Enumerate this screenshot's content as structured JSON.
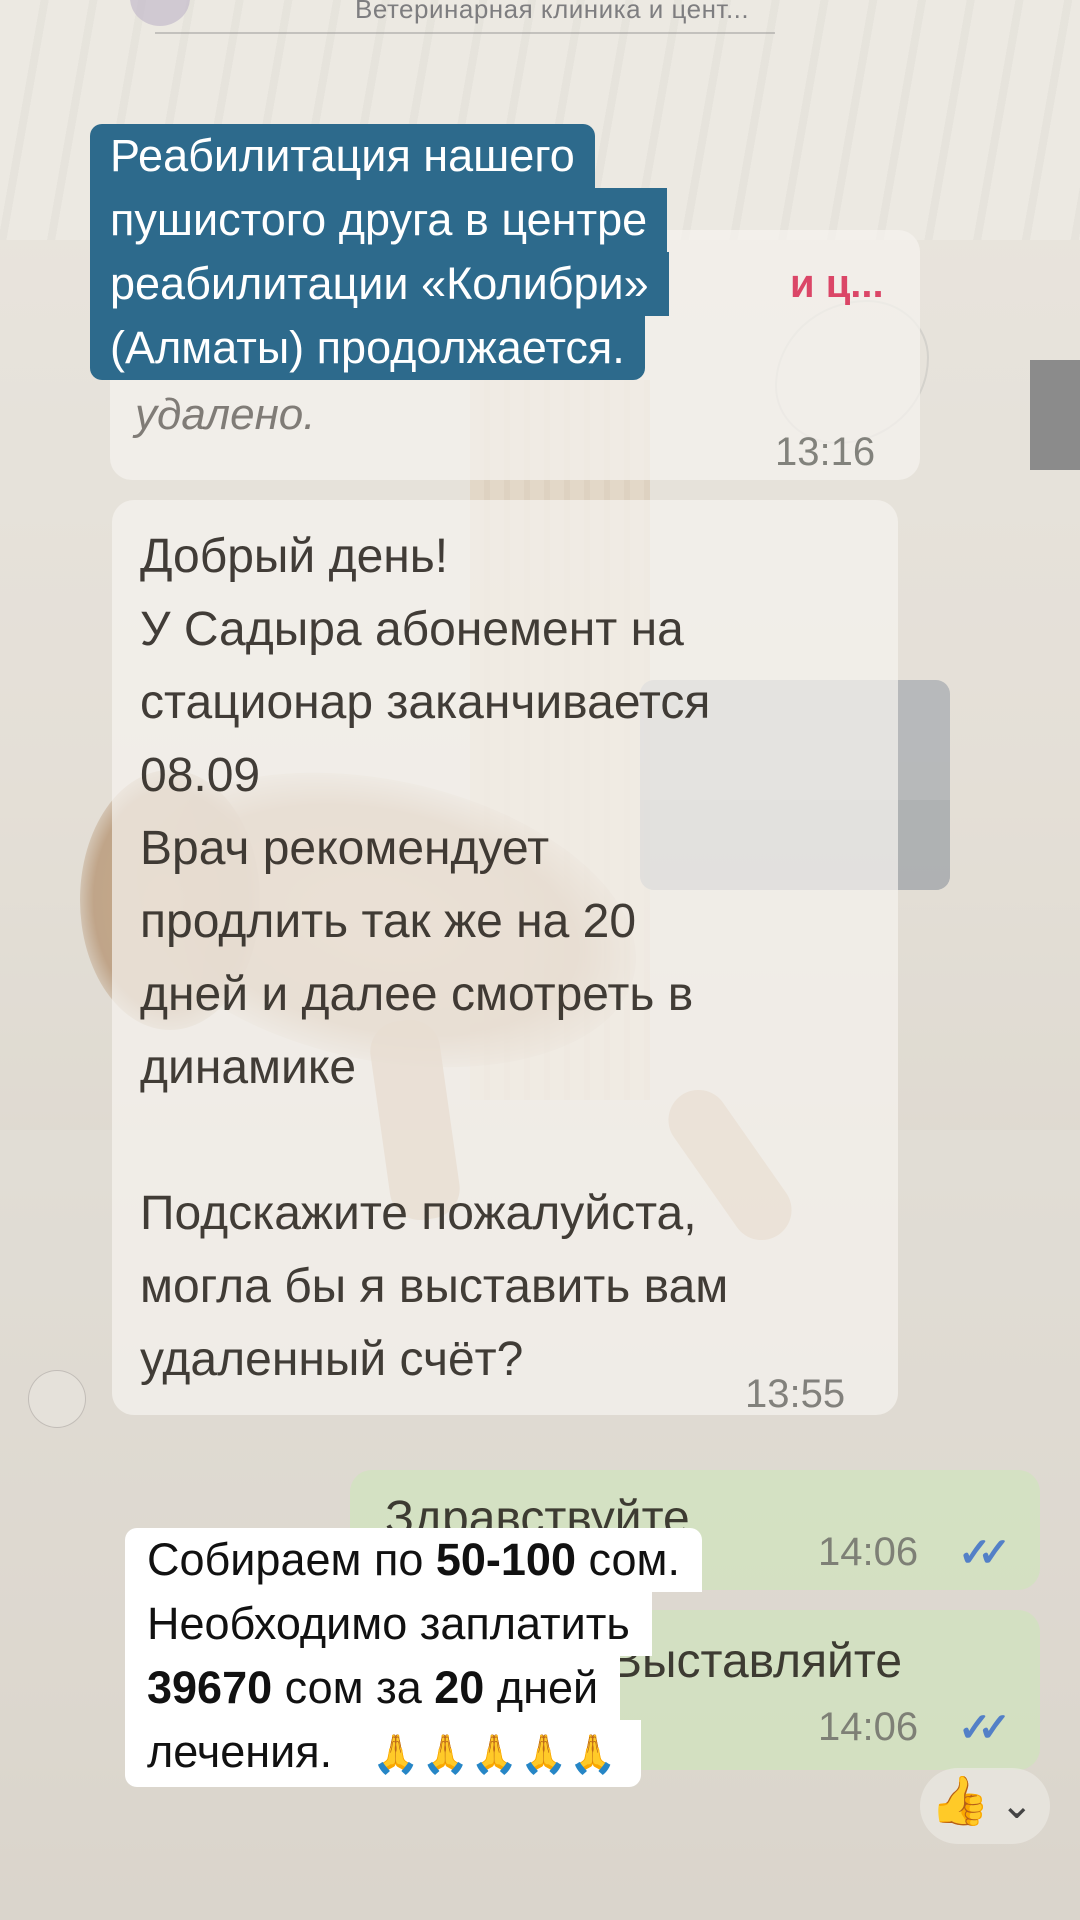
{
  "chat": {
    "title": "Ветеринарная клиника и цент...",
    "reply_preview": {
      "name_fragment": "и ц...",
      "deleted_text": "удалено.",
      "time": "13:16"
    },
    "incoming_message": {
      "text": "Добрый день!\nУ Садыра абонемент на\nстационар заканчивается\n08.09\nВрач рекомендует\nпродлить так же на 20\nдней и далее смотреть в\nдинамике\n\nПодскажите пожалуйста,\nмогла бы я выставить вам\nудаленный счёт?",
      "time": "13:55"
    },
    "outgoing_messages": [
      {
        "text": "Здравствуйте",
        "time": "14:06",
        "status": "read"
      },
      {
        "text": "Выставляйте",
        "time": "14:06",
        "status": "read"
      }
    ],
    "reaction": {
      "icon": "thumbs-up-icon",
      "emoji": "👍",
      "chevron": "⌄"
    }
  },
  "overlay_captions": {
    "top": {
      "lines": [
        "Реабилитация  нашего",
        "пушистого друга в центре",
        "реабилитации «Колибри»",
        "(Алматы) продолжается."
      ],
      "background": "#2d6a8c"
    },
    "bottom": {
      "line1_pre": "Собираем по ",
      "line1_bold": "50-100",
      "line1_post": " сом.",
      "line2": "Необходимо заплатить",
      "line3_bold1": "39670",
      "line3_mid": " сом за ",
      "line3_bold2": "20",
      "line3_post": " дней",
      "line4": "лечения.",
      "emoji": "🙏🙏🙏🙏🙏"
    }
  },
  "colors": {
    "read_ticks": "#3c6ec8",
    "reply_name": "#d72850"
  }
}
